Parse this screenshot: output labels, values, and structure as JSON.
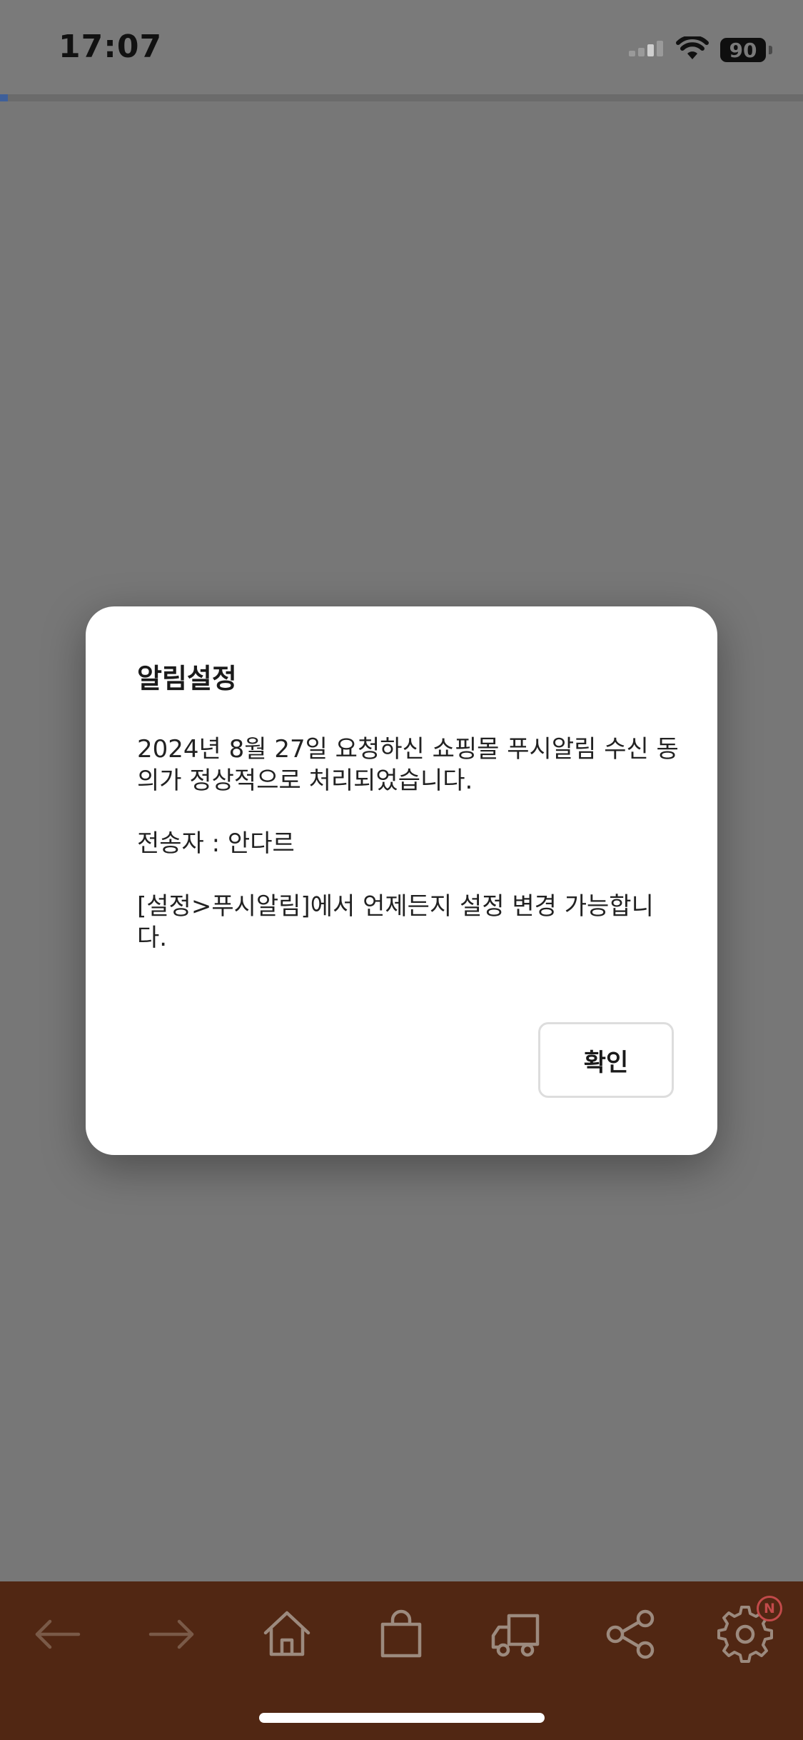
{
  "status_bar": {
    "time": "17:07",
    "battery": "90",
    "icons": [
      "cellular-signal-icon",
      "wifi-icon",
      "battery-icon"
    ]
  },
  "page_load_progress": 0.01,
  "dialog": {
    "title": "알림설정",
    "message_1": "2024년 8월 27일 요청하신 쇼핑몰 푸시알림 수신 동의가 정상적으로 처리되었습니다.",
    "message_2": "전송자 : 안다르",
    "message_3": "[설정>푸시알림]에서 언제든지 설정 변경 가능합니다.",
    "confirm_label": "확인"
  },
  "bottom_nav": {
    "items": [
      {
        "icon": "back-arrow-icon",
        "enabled": false
      },
      {
        "icon": "forward-arrow-icon",
        "enabled": false
      },
      {
        "icon": "home-icon",
        "enabled": true
      },
      {
        "icon": "shopping-bag-icon",
        "enabled": true
      },
      {
        "icon": "delivery-truck-icon",
        "enabled": true
      },
      {
        "icon": "share-icon",
        "enabled": true
      },
      {
        "icon": "settings-gear-icon",
        "enabled": true
      }
    ],
    "settings_badge": "N"
  },
  "colors": {
    "overlay": "#777777",
    "nav_background": "#512713",
    "icon_enabled": "#9c8a7e",
    "icon_disabled": "#7a5a48",
    "badge": "#c24a4a",
    "progress": "#3e5f9a"
  }
}
